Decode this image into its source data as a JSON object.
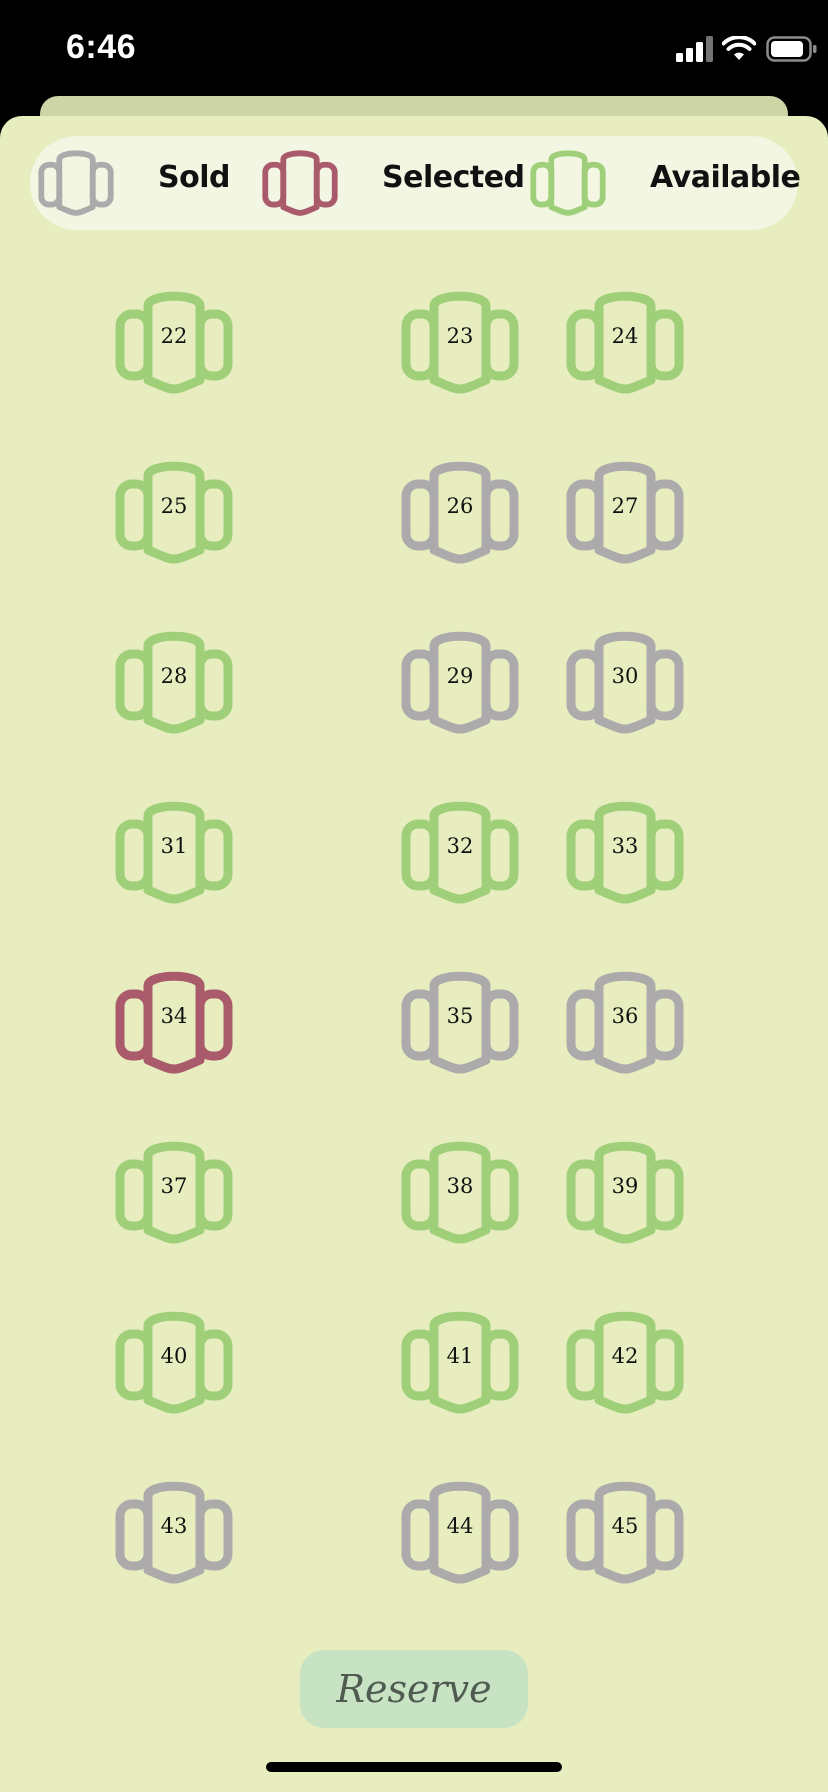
{
  "status_bar": {
    "time": "6:46",
    "icons": [
      "cellular-signal-icon",
      "wifi-icon",
      "battery-icon"
    ]
  },
  "legend": {
    "items": [
      {
        "label": "Sold",
        "state": "sold"
      },
      {
        "label": "Selected",
        "state": "selected"
      },
      {
        "label": "Available",
        "state": "available"
      }
    ]
  },
  "colors": {
    "sold": "#acaaab",
    "selected": "#aa5b6b",
    "available": "#9fcf79",
    "background": "#e7edbf",
    "legend_background": "#f2f6e3",
    "reserve_button": "#c8e3c3"
  },
  "seats": {
    "rows": [
      {
        "left": {
          "number": "22",
          "state": "available"
        },
        "right": [
          {
            "number": "23",
            "state": "available"
          },
          {
            "number": "24",
            "state": "available"
          }
        ]
      },
      {
        "left": {
          "number": "25",
          "state": "available"
        },
        "right": [
          {
            "number": "26",
            "state": "sold"
          },
          {
            "number": "27",
            "state": "sold"
          }
        ]
      },
      {
        "left": {
          "number": "28",
          "state": "available"
        },
        "right": [
          {
            "number": "29",
            "state": "sold"
          },
          {
            "number": "30",
            "state": "sold"
          }
        ]
      },
      {
        "left": {
          "number": "31",
          "state": "available"
        },
        "right": [
          {
            "number": "32",
            "state": "available"
          },
          {
            "number": "33",
            "state": "available"
          }
        ]
      },
      {
        "left": {
          "number": "34",
          "state": "selected"
        },
        "right": [
          {
            "number": "35",
            "state": "sold"
          },
          {
            "number": "36",
            "state": "sold"
          }
        ]
      },
      {
        "left": {
          "number": "37",
          "state": "available"
        },
        "right": [
          {
            "number": "38",
            "state": "available"
          },
          {
            "number": "39",
            "state": "available"
          }
        ]
      },
      {
        "left": {
          "number": "40",
          "state": "available"
        },
        "right": [
          {
            "number": "41",
            "state": "available"
          },
          {
            "number": "42",
            "state": "available"
          }
        ]
      },
      {
        "left": {
          "number": "43",
          "state": "sold"
        },
        "right": [
          {
            "number": "44",
            "state": "sold"
          },
          {
            "number": "45",
            "state": "sold"
          }
        ]
      }
    ]
  },
  "reserve_button": {
    "label": "Reserve"
  }
}
